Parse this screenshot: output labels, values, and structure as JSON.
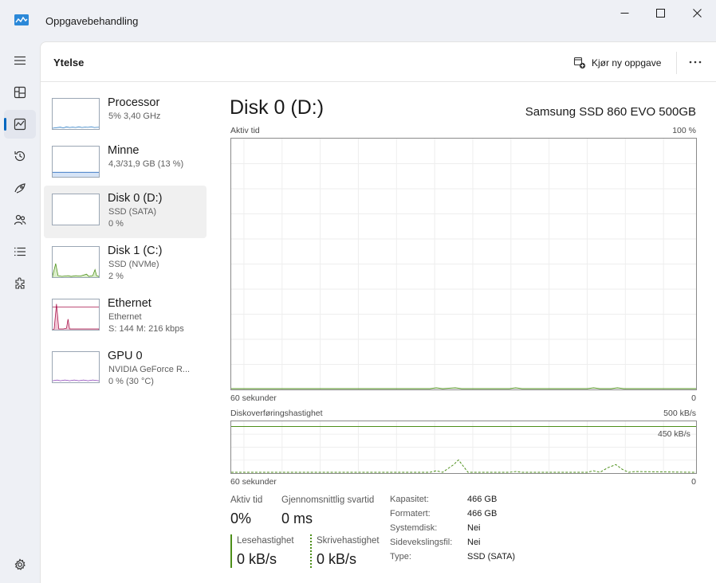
{
  "window": {
    "title": "Oppgavebehandling"
  },
  "header": {
    "heading": "Ytelse",
    "run_task_label": "Kjør ny oppgave",
    "more_label": "..."
  },
  "devices": [
    {
      "name": "Processor",
      "sub1": "5% 3,40 GHz",
      "sub2": ""
    },
    {
      "name": "Minne",
      "sub1": "4,3/31,9 GB (13 %)",
      "sub2": ""
    },
    {
      "name": "Disk 0 (D:)",
      "sub1": "SSD (SATA)",
      "sub2": "0 %"
    },
    {
      "name": "Disk 1 (C:)",
      "sub1": "SSD (NVMe)",
      "sub2": "2 %"
    },
    {
      "name": "Ethernet",
      "sub1": "Ethernet",
      "sub2": "S: 144 M: 216 kbps"
    },
    {
      "name": "GPU 0",
      "sub1": "NVIDIA GeForce R...",
      "sub2": "0 % (30 °C)"
    }
  ],
  "detail": {
    "title": "Disk 0 (D:)",
    "model": "Samsung SSD 860 EVO 500GB",
    "graph1": {
      "label": "Aktiv tid",
      "max": "100 %",
      "time": "60 sekunder",
      "min": "0"
    },
    "graph2": {
      "label": "Diskoverføringshastighet",
      "max": "500 kB/s",
      "inner": "450 kB/s",
      "time": "60 sekunder",
      "min": "0"
    },
    "stats": {
      "active_label": "Aktiv tid",
      "active_value": "0%",
      "resp_label": "Gjennomsnittlig svartid",
      "resp_value": "0 ms",
      "read_label": "Lesehastighet",
      "read_value": "0 kB/s",
      "write_label": "Skrivehastighet",
      "write_value": "0 kB/s"
    },
    "props": [
      {
        "key": "Kapasitet:",
        "value": "466 GB"
      },
      {
        "key": "Formatert:",
        "value": "466 GB"
      },
      {
        "key": "Systemdisk:",
        "value": "Nei"
      },
      {
        "key": "Sidevekslingsfil:",
        "value": "Nei"
      },
      {
        "key": "Type:",
        "value": "SSD (SATA)"
      }
    ]
  },
  "colors": {
    "accent": "#0067c0",
    "disk": "#4d8f1a",
    "ethernet": "#a8124a",
    "memory": "#2f6fc0",
    "gpu": "#8a3fb8"
  }
}
